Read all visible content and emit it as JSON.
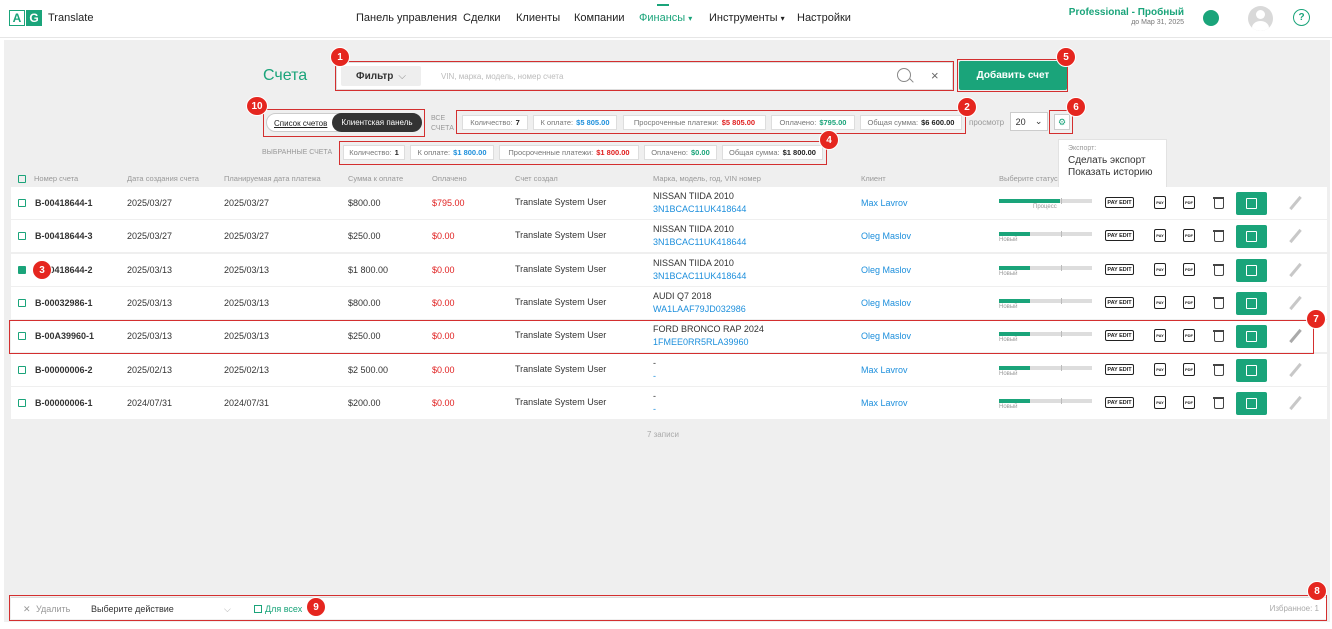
{
  "app": {
    "logo_a": "A",
    "logo_g": "G",
    "name": "Translate"
  },
  "nav": {
    "items": [
      "Панель управления",
      "Сделки",
      "Клиенты",
      "Компании",
      "Финансы",
      "Инструменты",
      "Настройки"
    ],
    "finance_caret": "▾",
    "tools_caret": "▾",
    "active": "Финансы"
  },
  "plan": {
    "name": "Professional - Пробный",
    "until": "до Мар 31, 2025"
  },
  "icons": {
    "bell": "bell-icon",
    "avatar": "user-avatar",
    "help": "?"
  },
  "page": {
    "title": "Счета",
    "filter_label": "Фильтр",
    "filter_caret": "⌵",
    "search_placeholder": "VIN, марка, модель, номер счета",
    "clear": "×",
    "add_button": "Добавить счет"
  },
  "toggle": {
    "list": "Список счетов",
    "client": "Клиентская панель"
  },
  "stats": {
    "all_label_1": "ВСЕ",
    "all_label_2": "СЧЕТА",
    "selected_label": "ВЫБРАННЫЕ СЧЕТА",
    "all": [
      {
        "label": "Количество:",
        "value": "7"
      },
      {
        "label": "К оплате:",
        "value": "$5 805.00"
      },
      {
        "label": "Просроченные платежи:",
        "value": "$5 805.00"
      },
      {
        "label": "Оплачено:",
        "value": "$795.00"
      },
      {
        "label": "Общая сумма:",
        "value": "$6 600.00"
      }
    ],
    "selected": [
      {
        "label": "Количество:",
        "value": "1"
      },
      {
        "label": "К оплате:",
        "value": "$1 800.00"
      },
      {
        "label": "Просроченные платежи:",
        "value": "$1 800.00"
      },
      {
        "label": "Оплачено:",
        "value": "$0.00"
      },
      {
        "label": "Общая сумма:",
        "value": "$1 800.00"
      }
    ]
  },
  "view": {
    "label": "просмотр",
    "value": "20",
    "caret": "⌄",
    "gear": "⚙"
  },
  "export": {
    "header": "Экспорт:",
    "items": [
      "Сделать экспорт",
      "Показать историю"
    ]
  },
  "table": {
    "headers": [
      "Номер счета",
      "Дата создания счета",
      "Планируемая дата платежа",
      "Сумма к оплате",
      "Оплачено",
      "Счет создал",
      "Марка, модель, год, VIN номер",
      "Клиент",
      "Выберите статус"
    ],
    "rows": [
      {
        "num": "B-00418644-1",
        "created": "2025/03/27",
        "planned": "2025/03/27",
        "amount": "$800.00",
        "paid": "$795.00",
        "creator": "Translate System User",
        "car": "NISSAN TIIDA 2010",
        "vin": "3N1BCAC11UK418644",
        "client": "Max Lavrov",
        "status": "Процесс",
        "progress": 0.66,
        "checked": false
      },
      {
        "num": "B-00418644-3",
        "created": "2025/03/27",
        "planned": "2025/03/27",
        "amount": "$250.00",
        "paid": "$0.00",
        "creator": "Translate System User",
        "car": "NISSAN TIIDA 2010",
        "vin": "3N1BCAC11UK418644",
        "client": "Oleg Maslov",
        "status": "Новый",
        "progress": 0.33,
        "checked": false
      },
      {
        "num": "B-00418644-2",
        "created": "2025/03/13",
        "planned": "2025/03/13",
        "amount": "$1 800.00",
        "paid": "$0.00",
        "creator": "Translate System User",
        "car": "NISSAN TIIDA 2010",
        "vin": "3N1BCAC11UK418644",
        "client": "Oleg Maslov",
        "status": "Новый",
        "progress": 0.33,
        "checked": true
      },
      {
        "num": "B-00032986-1",
        "created": "2025/03/13",
        "planned": "2025/03/13",
        "amount": "$800.00",
        "paid": "$0.00",
        "creator": "Translate System User",
        "car": "AUDI Q7 2018",
        "vin": "WA1LAAF79JD032986",
        "client": "Oleg Maslov",
        "status": "Новый",
        "progress": 0.33,
        "checked": false
      },
      {
        "num": "B-00A39960-1",
        "created": "2025/03/13",
        "planned": "2025/03/13",
        "amount": "$250.00",
        "paid": "$0.00",
        "creator": "Translate System User",
        "car": "FORD BRONCO RAP 2024",
        "vin": "1FMEE0RR5RLA39960",
        "client": "Oleg Maslov",
        "status": "Новый",
        "progress": 0.33,
        "checked": false
      },
      {
        "num": "B-00000006-2",
        "created": "2025/02/13",
        "planned": "2025/02/13",
        "amount": "$2 500.00",
        "paid": "$0.00",
        "creator": "Translate System User",
        "car": "-",
        "vin": "-",
        "client": "Max Lavrov",
        "status": "Новый",
        "progress": 0.33,
        "checked": false
      },
      {
        "num": "B-00000006-1",
        "created": "2024/07/31",
        "planned": "2024/07/31",
        "amount": "$200.00",
        "paid": "$0.00",
        "creator": "Translate System User",
        "car": "-",
        "vin": "-",
        "client": "Max Lavrov",
        "status": "Новый",
        "progress": 0.33,
        "checked": false
      }
    ],
    "pay_edit": "PAY EDIT",
    "pay_icon": "PAY",
    "pdf_icon": "PDF",
    "footer": "7 записи"
  },
  "bottom": {
    "x": "✕",
    "delete": "Удалить",
    "select_action": "Выберите действие",
    "dropdown": "⌵",
    "for_all": "Для всех",
    "favorites": "Избранное: 1"
  },
  "badges": [
    "1",
    "2",
    "3",
    "4",
    "5",
    "6",
    "7",
    "8",
    "9",
    "10"
  ],
  "colors": {
    "accent": "#1aa47a",
    "link": "#1d8fdc",
    "danger": "#e02020",
    "annotation": "#e5261f"
  }
}
